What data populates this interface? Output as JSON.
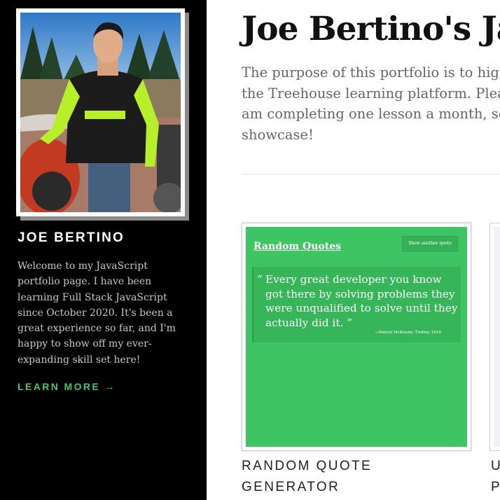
{
  "sidebar": {
    "name": "JOE BERTINO",
    "bio": "Welcome to my JavaScript portfolio page. I have been learning Full Stack JavaScript since October 2020. It's been a great experience so far, and I'm happy to show off my ever-expanding skill set here!",
    "learn_more": "LEARN MORE →",
    "accent_color": "#4ec26a"
  },
  "main": {
    "title": "Joe Bertino's Ja",
    "intro_lines": [
      "The purpose of this portfolio is to high",
      "the Treehouse learning platform. Plea",
      "am completing one lesson a month, so",
      "showcase!"
    ],
    "projects": [
      {
        "label_lines": [
          "RANDOM QUOTE",
          "GENERATOR"
        ],
        "preview": {
          "title": "Random Quotes",
          "button": "Show another quote",
          "quote_mark": "“",
          "quote": "Every great developer you know got there by solving problems they were unqualified to solve until they actually did it. ”",
          "attribution": "—Patrick McKenzie, Twitter, 2016",
          "bg_color": "#3ec463"
        }
      },
      {
        "label_lines": [
          "U",
          "P"
        ]
      }
    ]
  }
}
